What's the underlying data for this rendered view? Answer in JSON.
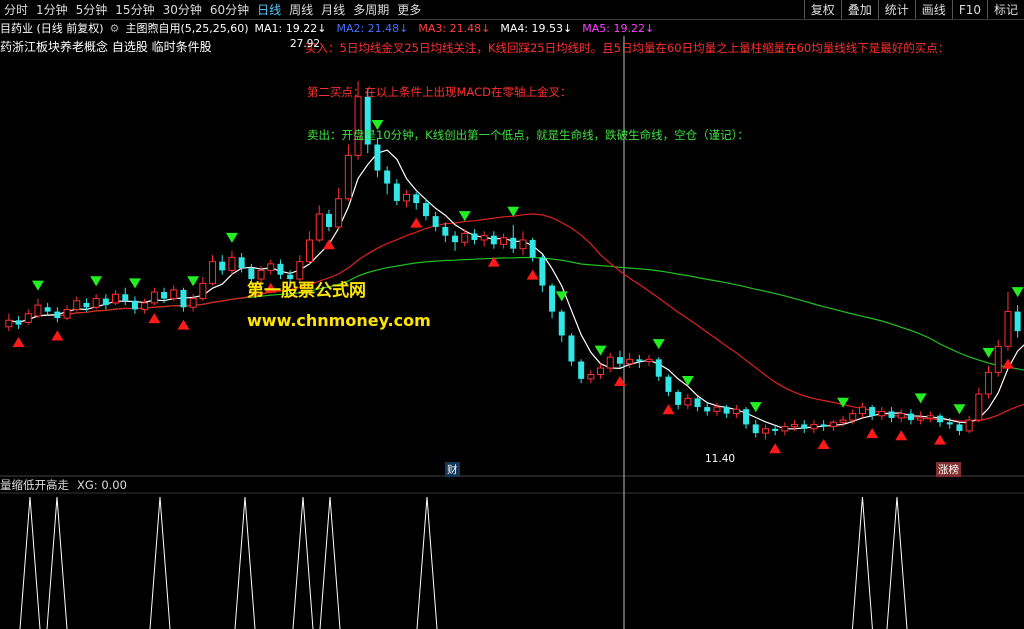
{
  "toolbar": {
    "periods": [
      {
        "label": "分时"
      },
      {
        "label": "1分钟"
      },
      {
        "label": "5分钟"
      },
      {
        "label": "15分钟"
      },
      {
        "label": "30分钟"
      },
      {
        "label": "60分钟"
      },
      {
        "label": "日线"
      },
      {
        "label": "周线"
      },
      {
        "label": "月线"
      },
      {
        "label": "多周期"
      },
      {
        "label": "更多"
      }
    ],
    "active_period": "日线",
    "right_buttons": [
      {
        "label": "复权"
      },
      {
        "label": "叠加"
      },
      {
        "label": "统计"
      },
      {
        "label": "画线"
      },
      {
        "label": "F10"
      },
      {
        "label": "标记"
      }
    ]
  },
  "info": {
    "stock_title": "目药业 (日线 前复权)",
    "indicator": "主图煦自用(5,25,25,60)",
    "ma": [
      {
        "label": "MA1: 19.22↓",
        "color": "#ffffff"
      },
      {
        "label": "MA2: 21.48↓",
        "color": "#4a6cff"
      },
      {
        "label": "MA3: 21.48↓",
        "color": "#ff4040"
      },
      {
        "label": "MA4: 19.53↓",
        "color": "#ffffff"
      },
      {
        "label": "MA5: 19.22↓",
        "color": "#ff40ff"
      }
    ]
  },
  "blocks": "药浙江板块养老概念 自选股 临时条件股",
  "annotations": {
    "buy1": "买入：5日均线金叉25日均线关注，K线回踩25日均线时。且5日均量在60日均量之上量柱缩量在60均量线线下是最好的买点：",
    "buy2": "第二买点：在以上条件上出现MACD在零轴上金叉：",
    "sell": "卖出：开盘是10分钟，K线创出第一个低点，就是生命线，跌破生命线，空仓（谨记）："
  },
  "watermark": {
    "line1": "第一股票公式网",
    "line2": "www.chnmoney.com"
  },
  "price_high": "27.92",
  "price_low": "11.40",
  "tag_cai": "财",
  "tag_zhangting": "涨榜",
  "lower": {
    "name": "量缩低开高走",
    "xg": "XG: 0.00"
  },
  "colors": {
    "up": "#ff3030",
    "down": "#33e6e6",
    "ma_white": "#ffffff",
    "ma_red": "#e02020",
    "ma_green": "#22c022",
    "buy_arrow": "#ff1a1a",
    "sell_arrow": "#22ee22"
  },
  "chart_data": {
    "type": "candlestick",
    "ylim": [
      10,
      30
    ],
    "candles": [
      {
        "o": 16.6,
        "c": 16.9,
        "h": 17.2,
        "l": 16.4
      },
      {
        "o": 16.9,
        "c": 16.7,
        "h": 17.1,
        "l": 16.5
      },
      {
        "o": 16.8,
        "c": 17.2,
        "h": 17.4,
        "l": 16.7
      },
      {
        "o": 17.1,
        "c": 17.6,
        "h": 17.9,
        "l": 17.0
      },
      {
        "o": 17.5,
        "c": 17.3,
        "h": 17.7,
        "l": 17.1
      },
      {
        "o": 17.3,
        "c": 17.0,
        "h": 17.5,
        "l": 16.8
      },
      {
        "o": 17.0,
        "c": 17.4,
        "h": 17.6,
        "l": 16.9
      },
      {
        "o": 17.4,
        "c": 17.8,
        "h": 18.0,
        "l": 17.3
      },
      {
        "o": 17.7,
        "c": 17.5,
        "h": 17.9,
        "l": 17.3
      },
      {
        "o": 17.5,
        "c": 17.9,
        "h": 18.1,
        "l": 17.4
      },
      {
        "o": 17.9,
        "c": 17.6,
        "h": 18.1,
        "l": 17.4
      },
      {
        "o": 17.7,
        "c": 18.1,
        "h": 18.3,
        "l": 17.6
      },
      {
        "o": 18.1,
        "c": 17.8,
        "h": 18.4,
        "l": 17.6
      },
      {
        "o": 17.8,
        "c": 17.4,
        "h": 18.0,
        "l": 17.2
      },
      {
        "o": 17.4,
        "c": 17.7,
        "h": 17.9,
        "l": 17.2
      },
      {
        "o": 17.7,
        "c": 18.2,
        "h": 18.4,
        "l": 17.6
      },
      {
        "o": 18.2,
        "c": 17.9,
        "h": 18.4,
        "l": 17.7
      },
      {
        "o": 17.9,
        "c": 18.3,
        "h": 18.5,
        "l": 17.8
      },
      {
        "o": 18.3,
        "c": 17.5,
        "h": 18.4,
        "l": 17.3
      },
      {
        "o": 17.5,
        "c": 17.9,
        "h": 18.1,
        "l": 17.3
      },
      {
        "o": 17.9,
        "c": 18.6,
        "h": 18.9,
        "l": 17.8
      },
      {
        "o": 18.6,
        "c": 19.6,
        "h": 19.9,
        "l": 18.5
      },
      {
        "o": 19.6,
        "c": 19.2,
        "h": 19.9,
        "l": 19.0
      },
      {
        "o": 19.2,
        "c": 19.8,
        "h": 20.1,
        "l": 19.0
      },
      {
        "o": 19.8,
        "c": 19.3,
        "h": 20.0,
        "l": 19.1
      },
      {
        "o": 19.3,
        "c": 18.8,
        "h": 19.5,
        "l": 18.6
      },
      {
        "o": 18.8,
        "c": 19.2,
        "h": 19.4,
        "l": 18.6
      },
      {
        "o": 19.2,
        "c": 19.5,
        "h": 19.7,
        "l": 19.0
      },
      {
        "o": 19.5,
        "c": 19.0,
        "h": 19.7,
        "l": 18.8
      },
      {
        "o": 19.0,
        "c": 18.8,
        "h": 19.2,
        "l": 18.6
      },
      {
        "o": 18.8,
        "c": 19.6,
        "h": 19.9,
        "l": 18.7
      },
      {
        "o": 19.6,
        "c": 20.6,
        "h": 21.0,
        "l": 19.5
      },
      {
        "o": 20.6,
        "c": 21.8,
        "h": 22.2,
        "l": 20.5
      },
      {
        "o": 21.8,
        "c": 21.2,
        "h": 22.0,
        "l": 21.0
      },
      {
        "o": 21.2,
        "c": 22.5,
        "h": 23.0,
        "l": 21.1
      },
      {
        "o": 22.5,
        "c": 24.5,
        "h": 25.0,
        "l": 22.4
      },
      {
        "o": 24.5,
        "c": 27.2,
        "h": 27.92,
        "l": 24.3
      },
      {
        "o": 27.2,
        "c": 25.0,
        "h": 27.6,
        "l": 24.6
      },
      {
        "o": 25.0,
        "c": 23.8,
        "h": 25.3,
        "l": 23.5
      },
      {
        "o": 23.8,
        "c": 23.2,
        "h": 24.0,
        "l": 22.7
      },
      {
        "o": 23.2,
        "c": 22.4,
        "h": 23.4,
        "l": 22.2
      },
      {
        "o": 22.4,
        "c": 22.7,
        "h": 22.9,
        "l": 22.1
      },
      {
        "o": 22.7,
        "c": 22.3,
        "h": 22.8,
        "l": 22.0
      },
      {
        "o": 22.3,
        "c": 21.7,
        "h": 22.5,
        "l": 21.5
      },
      {
        "o": 21.7,
        "c": 21.2,
        "h": 21.9,
        "l": 21.0
      },
      {
        "o": 21.2,
        "c": 20.8,
        "h": 21.4,
        "l": 20.5
      },
      {
        "o": 20.8,
        "c": 20.5,
        "h": 21.0,
        "l": 20.1
      },
      {
        "o": 20.5,
        "c": 20.9,
        "h": 21.1,
        "l": 20.3
      },
      {
        "o": 20.9,
        "c": 20.6,
        "h": 21.1,
        "l": 20.4
      },
      {
        "o": 20.6,
        "c": 20.8,
        "h": 21.0,
        "l": 20.3
      },
      {
        "o": 20.8,
        "c": 20.4,
        "h": 21.0,
        "l": 20.2
      },
      {
        "o": 20.4,
        "c": 20.7,
        "h": 20.9,
        "l": 20.2
      },
      {
        "o": 20.7,
        "c": 20.2,
        "h": 21.3,
        "l": 20.0
      },
      {
        "o": 20.2,
        "c": 20.6,
        "h": 21.0,
        "l": 19.9
      },
      {
        "o": 20.6,
        "c": 19.8,
        "h": 20.7,
        "l": 19.6
      },
      {
        "o": 19.8,
        "c": 18.5,
        "h": 19.9,
        "l": 18.2
      },
      {
        "o": 18.5,
        "c": 17.3,
        "h": 18.6,
        "l": 17.0
      },
      {
        "o": 17.3,
        "c": 16.2,
        "h": 17.4,
        "l": 15.9
      },
      {
        "o": 16.2,
        "c": 15.0,
        "h": 16.3,
        "l": 14.8
      },
      {
        "o": 15.0,
        "c": 14.2,
        "h": 15.1,
        "l": 14.0
      },
      {
        "o": 14.2,
        "c": 14.4,
        "h": 14.6,
        "l": 14.0
      },
      {
        "o": 14.4,
        "c": 14.7,
        "h": 14.9,
        "l": 14.2
      },
      {
        "o": 14.7,
        "c": 15.2,
        "h": 15.4,
        "l": 14.5
      },
      {
        "o": 15.2,
        "c": 14.9,
        "h": 15.5,
        "l": 14.7
      },
      {
        "o": 14.9,
        "c": 15.1,
        "h": 15.4,
        "l": 14.7
      },
      {
        "o": 15.1,
        "c": 15.0,
        "h": 15.3,
        "l": 14.7
      },
      {
        "o": 15.0,
        "c": 15.1,
        "h": 15.3,
        "l": 14.8
      },
      {
        "o": 15.1,
        "c": 14.3,
        "h": 15.2,
        "l": 14.1
      },
      {
        "o": 14.3,
        "c": 13.6,
        "h": 14.4,
        "l": 13.4
      },
      {
        "o": 13.6,
        "c": 13.0,
        "h": 13.7,
        "l": 12.8
      },
      {
        "o": 13.0,
        "c": 13.3,
        "h": 13.5,
        "l": 12.8
      },
      {
        "o": 13.3,
        "c": 12.9,
        "h": 13.4,
        "l": 12.7
      },
      {
        "o": 12.9,
        "c": 12.7,
        "h": 13.1,
        "l": 12.5
      },
      {
        "o": 12.7,
        "c": 12.9,
        "h": 13.1,
        "l": 12.5
      },
      {
        "o": 12.9,
        "c": 12.6,
        "h": 13.0,
        "l": 12.4
      },
      {
        "o": 12.6,
        "c": 12.8,
        "h": 13.0,
        "l": 12.4
      },
      {
        "o": 12.8,
        "c": 12.1,
        "h": 12.9,
        "l": 11.9
      },
      {
        "o": 12.1,
        "c": 11.7,
        "h": 12.3,
        "l": 11.5
      },
      {
        "o": 11.7,
        "c": 11.9,
        "h": 12.1,
        "l": 11.4
      },
      {
        "o": 11.9,
        "c": 11.8,
        "h": 12.1,
        "l": 11.6
      },
      {
        "o": 11.8,
        "c": 12.0,
        "h": 12.2,
        "l": 11.6
      },
      {
        "o": 12.0,
        "c": 12.1,
        "h": 12.3,
        "l": 11.8
      },
      {
        "o": 12.1,
        "c": 11.9,
        "h": 12.3,
        "l": 11.7
      },
      {
        "o": 11.9,
        "c": 12.1,
        "h": 12.3,
        "l": 11.7
      },
      {
        "o": 12.1,
        "c": 12.0,
        "h": 12.3,
        "l": 11.8
      },
      {
        "o": 12.0,
        "c": 12.2,
        "h": 12.3,
        "l": 11.8
      },
      {
        "o": 12.2,
        "c": 12.3,
        "h": 12.5,
        "l": 12.0
      },
      {
        "o": 12.3,
        "c": 12.6,
        "h": 12.8,
        "l": 12.1
      },
      {
        "o": 12.6,
        "c": 12.9,
        "h": 13.1,
        "l": 12.4
      },
      {
        "o": 12.9,
        "c": 12.5,
        "h": 13.0,
        "l": 12.3
      },
      {
        "o": 12.5,
        "c": 12.7,
        "h": 12.9,
        "l": 12.3
      },
      {
        "o": 12.7,
        "c": 12.4,
        "h": 12.9,
        "l": 12.2
      },
      {
        "o": 12.4,
        "c": 12.6,
        "h": 12.8,
        "l": 12.2
      },
      {
        "o": 12.6,
        "c": 12.3,
        "h": 12.8,
        "l": 12.1
      },
      {
        "o": 12.3,
        "c": 12.4,
        "h": 12.7,
        "l": 12.1
      },
      {
        "o": 12.4,
        "c": 12.5,
        "h": 12.7,
        "l": 12.2
      },
      {
        "o": 12.5,
        "c": 12.2,
        "h": 12.6,
        "l": 12.0
      },
      {
        "o": 12.2,
        "c": 12.1,
        "h": 12.4,
        "l": 11.9
      },
      {
        "o": 12.1,
        "c": 11.8,
        "h": 12.2,
        "l": 11.6
      },
      {
        "o": 11.8,
        "c": 12.3,
        "h": 12.5,
        "l": 11.7
      },
      {
        "o": 12.3,
        "c": 13.5,
        "h": 13.8,
        "l": 12.2
      },
      {
        "o": 13.5,
        "c": 14.5,
        "h": 14.8,
        "l": 13.3
      },
      {
        "o": 14.5,
        "c": 15.7,
        "h": 16.0,
        "l": 14.3
      },
      {
        "o": 15.7,
        "c": 17.3,
        "h": 18.2,
        "l": 15.5
      },
      {
        "o": 17.3,
        "c": 16.4,
        "h": 17.6,
        "l": 16.1
      },
      {
        "o": 16.4,
        "c": 15.6,
        "h": 16.6,
        "l": 15.3
      },
      {
        "o": 15.6,
        "c": 14.8,
        "h": 15.8,
        "l": 14.5
      },
      {
        "o": 14.8,
        "c": 14.2,
        "h": 15.0,
        "l": 14.0
      },
      {
        "o": 14.2,
        "c": 14.0,
        "h": 14.4,
        "l": 13.8
      },
      {
        "o": 14.0,
        "c": 14.3,
        "h": 14.5,
        "l": 13.8
      },
      {
        "o": 14.3,
        "c": 14.1,
        "h": 14.5,
        "l": 13.9
      },
      {
        "o": 14.1,
        "c": 13.6,
        "h": 14.2,
        "l": 12.5
      }
    ],
    "buy_signals": [
      1,
      5,
      15,
      18,
      27,
      33,
      42,
      50,
      54,
      63,
      68,
      79,
      84,
      89,
      92,
      96,
      103
    ],
    "sell_signals": [
      3,
      9,
      13,
      19,
      23,
      38,
      47,
      52,
      57,
      61,
      67,
      70,
      77,
      86,
      94,
      98,
      101,
      104
    ],
    "xg_signals": [
      3,
      6,
      17,
      25,
      30,
      33,
      43,
      56,
      88
    ],
    "lines": {
      "ma_short": "white",
      "ma_mid": "red",
      "ma_long": "green"
    }
  }
}
